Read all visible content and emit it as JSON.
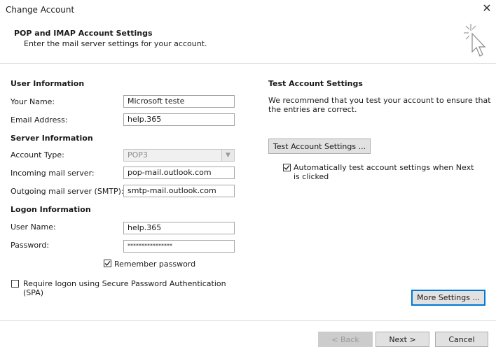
{
  "window": {
    "title": "Change Account",
    "close_glyph": "✕"
  },
  "header": {
    "title": "POP and IMAP Account Settings",
    "subtitle": "Enter the mail server settings for your account."
  },
  "left": {
    "user_info": {
      "heading": "User Information",
      "your_name_label": "Your Name:",
      "your_name_value": "Microsoft teste",
      "email_label": "Email Address:",
      "email_value": "help.365"
    },
    "server_info": {
      "heading": "Server Information",
      "account_type_label": "Account Type:",
      "account_type_value": "POP3",
      "incoming_label": "Incoming mail server:",
      "incoming_value": "pop-mail.outlook.com",
      "outgoing_label": "Outgoing mail server (SMTP):",
      "outgoing_value": "smtp-mail.outlook.com"
    },
    "logon_info": {
      "heading": "Logon Information",
      "username_label": "User Name:",
      "username_value": "help.365",
      "password_label": "Password:",
      "password_value": "****************",
      "remember_label": "Remember password",
      "remember_checked": true,
      "spa_label_line1": "Require logon using Secure Password Authentication",
      "spa_label_line2": "(SPA)",
      "spa_checked": false
    }
  },
  "right": {
    "heading": "Test Account Settings",
    "desc_line1": "We recommend that you test your account to ensure that",
    "desc_line2": "the entries are correct.",
    "test_button": "Test Account Settings ...",
    "auto_test_line1": "Automatically test account settings when Next",
    "auto_test_line2": "is clicked",
    "auto_test_checked": true,
    "more_settings_button": "More Settings ..."
  },
  "footer": {
    "back_button": "< Back",
    "next_button": "Next >",
    "cancel_button": "Cancel"
  },
  "icons": {
    "wizard": "wizard-sparkle-cursor-icon",
    "close": "close-icon",
    "dropdown": "chevron-down-icon",
    "check": "checkmark-icon"
  }
}
